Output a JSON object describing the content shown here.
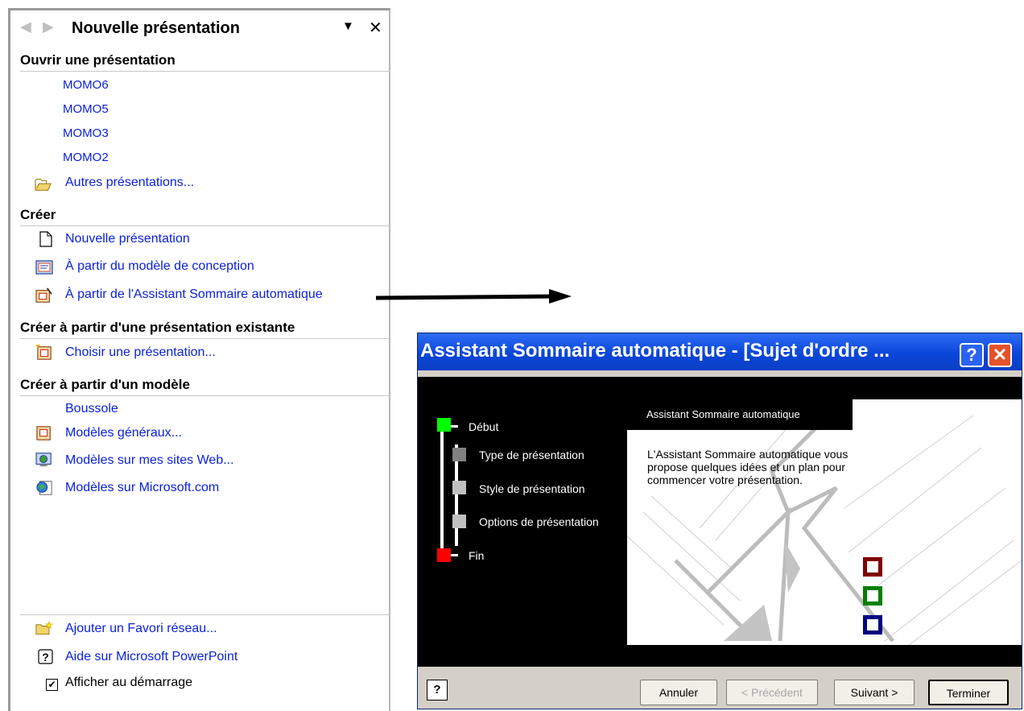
{
  "pane": {
    "title": "Nouvelle présentation",
    "back_icon": "back-arrow-icon",
    "forward_icon": "forward-arrow-icon",
    "dropdown_icon": "chevron-down-icon",
    "close_icon": "close-icon",
    "open_section": {
      "title": "Ouvrir une présentation",
      "recent": [
        "MOMO6",
        "MOMO5",
        "MOMO3",
        "MOMO2"
      ],
      "more": "Autres présentations..."
    },
    "create_section": {
      "title": "Créer",
      "items": [
        "Nouvelle présentation",
        "À partir du modèle de conception",
        "À partir de l'Assistant Sommaire automatique"
      ]
    },
    "existing_section": {
      "title": "Créer à partir d'une présentation existante",
      "item": "Choisir une présentation..."
    },
    "template_section": {
      "title": "Créer à partir d'un modèle",
      "recent": "Boussole",
      "items": [
        "Modèles généraux...",
        "Modèles sur mes sites Web...",
        "Modèles sur Microsoft.com"
      ]
    },
    "footer": {
      "add_favorite": "Ajouter un Favori réseau...",
      "help": "Aide sur Microsoft PowerPoint",
      "show_startup": "Afficher au démarrage",
      "show_startup_checked": true
    },
    "link_color": "#0b21d9"
  },
  "dialog": {
    "title": "Assistant Sommaire automatique - [Sujet d'ordre ...",
    "help_button": "?",
    "close_button": "✕",
    "steps": [
      {
        "label": "Début",
        "color": "#00ff00"
      },
      {
        "label": "Type de présentation",
        "color": "#808080"
      },
      {
        "label": "Style de présentation",
        "color": "#c0c0c0"
      },
      {
        "label": "Options de présentation",
        "color": "#c0c0c0"
      },
      {
        "label": "Fin",
        "color": "#ff0000"
      }
    ],
    "content_title": "Assistant Sommaire automatique",
    "content_text": "L'Assistant Sommaire automatique vous propose quelques idées et un plan pour commencer votre présentation.",
    "buttons": {
      "cancel": "Annuler",
      "previous": "< Précédent",
      "next": "Suivant >",
      "finish": "Terminer"
    },
    "footer_help": "?",
    "square_colors": [
      "#7f0000",
      "#008000",
      "#00007f"
    ]
  }
}
